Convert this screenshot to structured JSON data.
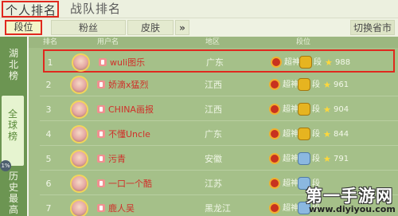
{
  "top_tabs": {
    "personal": "个人排名",
    "team": "战队排名"
  },
  "sub_tabs": {
    "rank": "段位",
    "fans": "粉丝",
    "skin": "皮肤",
    "more": "»",
    "switch_province": "切换省市"
  },
  "left_nav": {
    "province": [
      "湖",
      "北",
      "榜"
    ],
    "global": [
      "全",
      "球",
      "榜"
    ],
    "history": [
      "历",
      "史",
      "最",
      "高"
    ],
    "online_dot": "1%"
  },
  "table_headers": {
    "rank": "排名",
    "user": "用户名",
    "region": "地区",
    "tier": "段位"
  },
  "rows": [
    {
      "rank": "1",
      "name": "wuli图乐",
      "region": "广东",
      "rank_text": "超神",
      "dan": "段",
      "points": "988"
    },
    {
      "rank": "2",
      "name": "娇滴x猛烈",
      "region": "江西",
      "rank_text": "超神",
      "dan": "段",
      "points": "961"
    },
    {
      "rank": "3",
      "name": "CHINA画报",
      "region": "江西",
      "rank_text": "超神",
      "dan": "段",
      "points": "904"
    },
    {
      "rank": "4",
      "name": "不懂Uncle",
      "region": "广东",
      "rank_text": "超神",
      "dan": "段",
      "points": "844"
    },
    {
      "rank": "5",
      "name": "污青",
      "region": "安徽",
      "rank_text": "超神",
      "dan": "段",
      "points": "791"
    },
    {
      "rank": "6",
      "name": "一口一个酷",
      "region": "江苏",
      "rank_text": "超神",
      "dan": "段",
      "points": ""
    },
    {
      "rank": "7",
      "name": "鹿人吴",
      "region": "黑龙江",
      "rank_text": "超神",
      "dan": "段",
      "points": ""
    }
  ],
  "watermark": {
    "title": "第一手游网",
    "url": "www.diyiyou.com"
  },
  "colors": {
    "highlight": "#e0281e",
    "name": "#d0302a",
    "nav_green": "#6c9552",
    "panel_green": "#a5c089"
  }
}
